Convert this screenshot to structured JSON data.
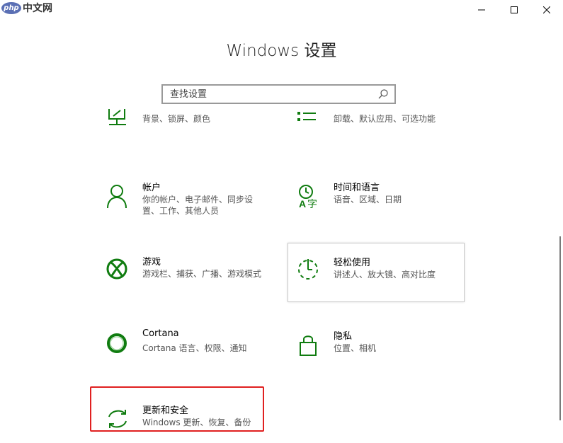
{
  "watermark": {
    "badge": "php",
    "text": "中文网"
  },
  "window": {
    "title": "Windows 设置"
  },
  "search": {
    "placeholder": "查找设置"
  },
  "colors": {
    "accent": "#107c10",
    "highlight": "#e02020"
  },
  "tiles": [
    {
      "name": "",
      "desc": "背景、锁屏、颜色",
      "icon": "personalization-icon"
    },
    {
      "name": "",
      "desc": "卸载、默认应用、可选功能",
      "icon": "apps-icon"
    },
    {
      "name": "帐户",
      "desc": "你的帐户、电子邮件、同步设置、工作、其他人员",
      "icon": "person-icon"
    },
    {
      "name": "时间和语言",
      "desc": "语音、区域、日期",
      "icon": "time-language-icon"
    },
    {
      "name": "游戏",
      "desc": "游戏栏、捕获、广播、游戏模式",
      "icon": "xbox-icon"
    },
    {
      "name": "轻松使用",
      "desc": "讲述人、放大镜、高对比度",
      "icon": "ease-of-access-icon"
    },
    {
      "name": "Cortana",
      "desc": "Cortana 语言、权限、通知",
      "icon": "cortana-icon"
    },
    {
      "name": "隐私",
      "desc": "位置、相机",
      "icon": "lock-icon"
    },
    {
      "name": "更新和安全",
      "desc": "Windows 更新、恢复、备份",
      "icon": "update-icon"
    }
  ]
}
